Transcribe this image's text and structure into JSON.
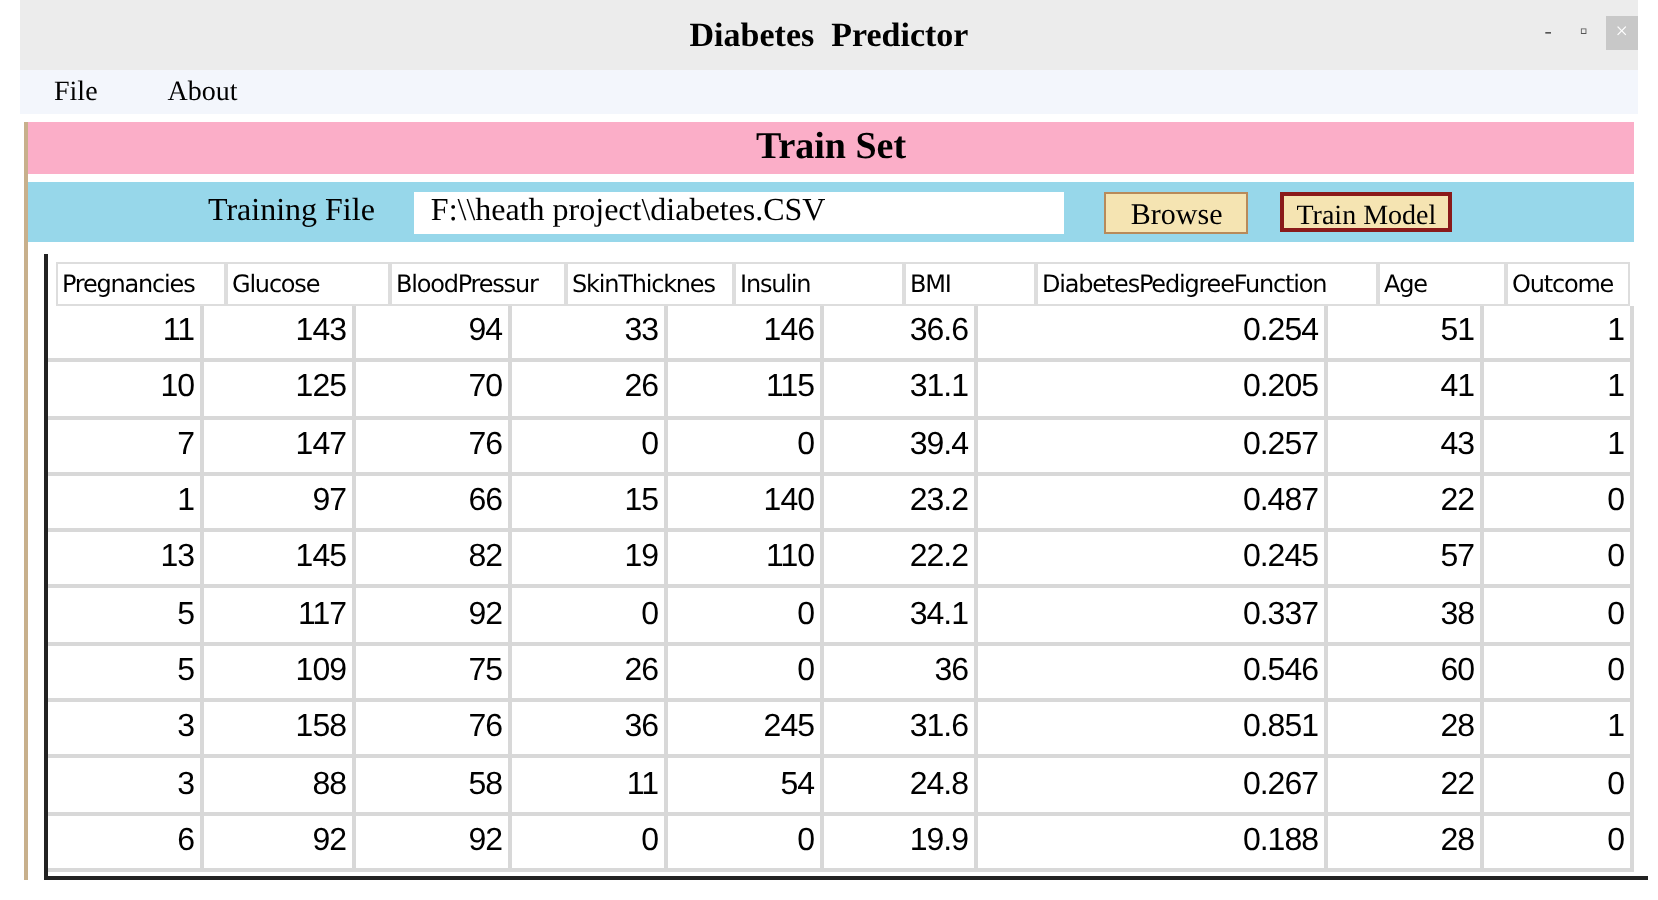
{
  "window": {
    "title": "Diabetes  Predictor",
    "controls": [
      "-",
      "▫",
      "×"
    ]
  },
  "menu": [
    "File",
    "About"
  ],
  "section_title": "Train Set",
  "training_file": {
    "label": "Training File",
    "value": "F:\\\\heath project\\diabetes.CSV"
  },
  "buttons": [
    "Browse",
    "Train Model"
  ],
  "table": {
    "columns": [
      "Pregnancies",
      "Glucose",
      "BloodPressur",
      "SkinThicknes",
      "Insulin",
      "BMI",
      "DiabetesPedigreeFunction",
      "Age",
      "Outcome"
    ],
    "rows": [
      [
        "11",
        "143",
        "94",
        "33",
        "146",
        "36.6",
        "0.254",
        "51",
        "1"
      ],
      [
        "10",
        "125",
        "70",
        "26",
        "115",
        "31.1",
        "0.205",
        "41",
        "1"
      ],
      [
        "7",
        "147",
        "76",
        "0",
        "0",
        "39.4",
        "0.257",
        "43",
        "1"
      ],
      [
        "1",
        "97",
        "66",
        "15",
        "140",
        "23.2",
        "0.487",
        "22",
        "0"
      ],
      [
        "13",
        "145",
        "82",
        "19",
        "110",
        "22.2",
        "0.245",
        "57",
        "0"
      ],
      [
        "5",
        "117",
        "92",
        "0",
        "0",
        "34.1",
        "0.337",
        "38",
        "0"
      ],
      [
        "5",
        "109",
        "75",
        "26",
        "0",
        "36",
        "0.546",
        "60",
        "0"
      ],
      [
        "3",
        "158",
        "76",
        "36",
        "245",
        "31.6",
        "0.851",
        "28",
        "1"
      ],
      [
        "3",
        "88",
        "58",
        "11",
        "54",
        "24.8",
        "0.267",
        "22",
        "0"
      ],
      [
        "6",
        "92",
        "92",
        "0",
        "0",
        "19.9",
        "0.188",
        "28",
        "0"
      ]
    ]
  }
}
